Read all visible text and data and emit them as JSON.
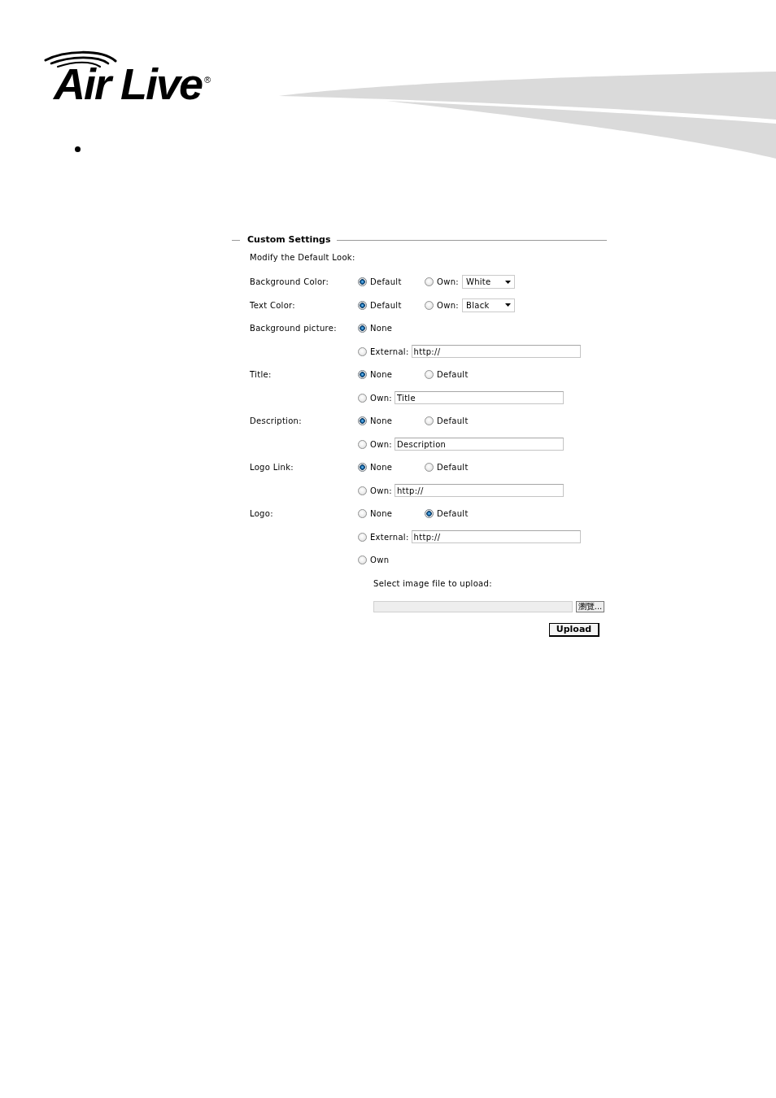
{
  "header": {
    "logo_text": "Air Live",
    "logo_mark": "®"
  },
  "form": {
    "legend": "Custom Settings",
    "intro": "Modify the Default Look:",
    "settings": [
      {
        "label": "Background Color:",
        "lines": [
          [
            {
              "kind": "radio",
              "label": "Default",
              "selected": true
            },
            {
              "kind": "radio",
              "label": "Own:",
              "selected": false
            },
            {
              "kind": "select",
              "value": "White"
            }
          ]
        ]
      },
      {
        "label": "Text Color:",
        "lines": [
          [
            {
              "kind": "radio",
              "label": "Default",
              "selected": true
            },
            {
              "kind": "radio",
              "label": "Own:",
              "selected": false
            },
            {
              "kind": "select",
              "value": "Black"
            }
          ]
        ]
      },
      {
        "label": "Background picture:",
        "lines": [
          [
            {
              "kind": "radio",
              "label": "None",
              "selected": true
            }
          ],
          [
            {
              "kind": "radio",
              "label": "External:",
              "selected": false
            },
            {
              "kind": "text",
              "value": "http://"
            }
          ]
        ]
      },
      {
        "label": "Title:",
        "lines": [
          [
            {
              "kind": "radio",
              "label": "None",
              "selected": true
            },
            {
              "kind": "radio",
              "label": "Default",
              "selected": false
            }
          ],
          [
            {
              "kind": "radio",
              "label": "Own:",
              "selected": false
            },
            {
              "kind": "text",
              "value": "Title"
            }
          ]
        ]
      },
      {
        "label": "Description:",
        "lines": [
          [
            {
              "kind": "radio",
              "label": "None",
              "selected": true
            },
            {
              "kind": "radio",
              "label": "Default",
              "selected": false
            }
          ],
          [
            {
              "kind": "radio",
              "label": "Own:",
              "selected": false
            },
            {
              "kind": "text",
              "value": "Description"
            }
          ]
        ]
      },
      {
        "label": "Logo Link:",
        "lines": [
          [
            {
              "kind": "radio",
              "label": "None",
              "selected": true
            },
            {
              "kind": "radio",
              "label": "Default",
              "selected": false
            }
          ],
          [
            {
              "kind": "radio",
              "label": "Own:",
              "selected": false
            },
            {
              "kind": "text",
              "value": "http://"
            }
          ]
        ]
      },
      {
        "label": "Logo:",
        "lines": [
          [
            {
              "kind": "radio",
              "label": "None",
              "selected": false
            },
            {
              "kind": "radio",
              "label": "Default",
              "selected": true
            }
          ],
          [
            {
              "kind": "radio",
              "label": "External:",
              "selected": false
            },
            {
              "kind": "text",
              "value": "http://"
            }
          ],
          [
            {
              "kind": "radio",
              "label": "Own",
              "selected": false
            }
          ],
          [
            {
              "kind": "note",
              "text": "Select image file to upload:"
            }
          ],
          [
            {
              "kind": "file",
              "button": "瀏覽..."
            }
          ]
        ]
      }
    ],
    "actions": [
      {
        "label": "Upload"
      }
    ]
  }
}
